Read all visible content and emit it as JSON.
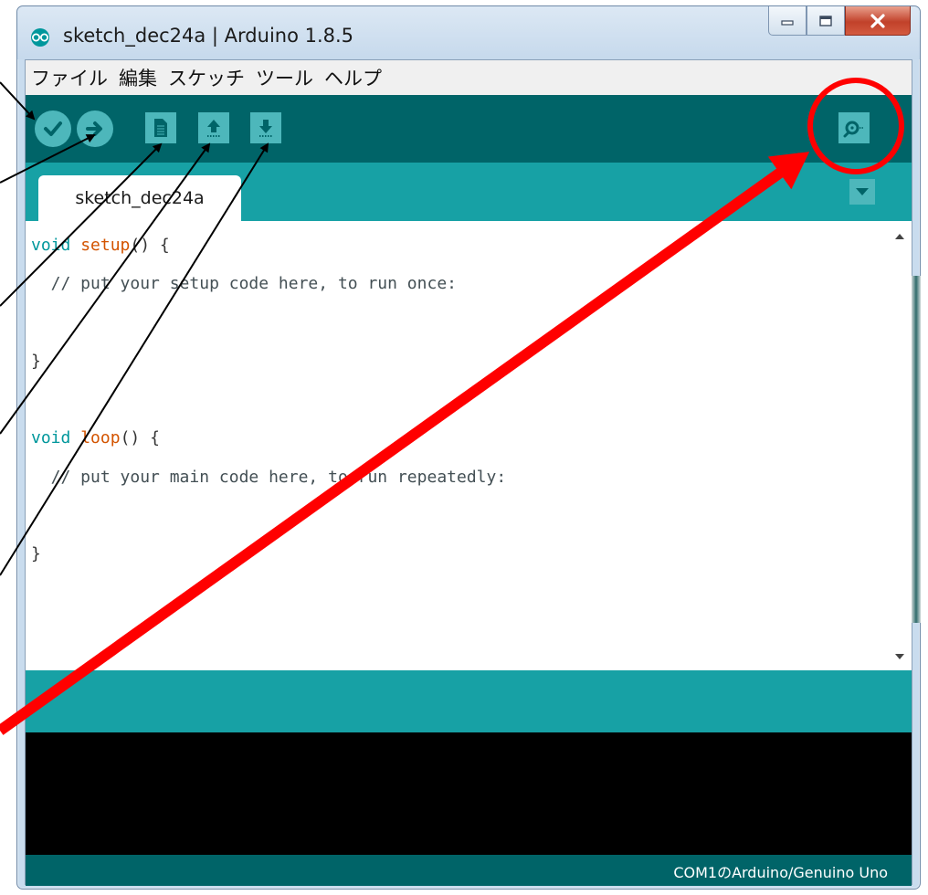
{
  "window": {
    "title": "sketch_dec24a | Arduino 1.8.5",
    "icon": "arduino-logo-icon"
  },
  "window_controls": {
    "minimize_icon": "minimize-icon",
    "maximize_icon": "maximize-icon",
    "close_icon": "close-icon"
  },
  "menu": {
    "items": [
      "ファイル",
      "編集",
      "スケッチ",
      "ツール",
      "ヘルプ"
    ]
  },
  "toolbar": {
    "buttons": [
      {
        "icon": "verify-icon"
      },
      {
        "icon": "upload-icon"
      },
      {
        "icon": "new-file-icon"
      },
      {
        "icon": "open-icon"
      },
      {
        "icon": "save-icon"
      }
    ],
    "serial_monitor_icon": "serial-monitor-icon"
  },
  "tabs": {
    "active": "sketch_dec24a",
    "menu_icon": "tab-menu-icon"
  },
  "editor": {
    "lines": [
      {
        "kw": "void",
        "fn": "setup",
        "rest": "() {"
      },
      {
        "text": "  // put your setup code here, to run once:"
      },
      {
        "text": ""
      },
      {
        "text": "}"
      },
      {
        "text": ""
      },
      {
        "kw": "void",
        "fn": "loop",
        "rest": "() {"
      },
      {
        "text": "  // put your main code here, to run repeatedly:"
      },
      {
        "text": ""
      },
      {
        "text": "}"
      }
    ]
  },
  "status": {
    "board": "COM1のArduino/Genuino Uno"
  },
  "colors": {
    "toolbar": "#006468",
    "tabbar": "#17a1a5",
    "button": "#4db7bb",
    "keyword": "#00979c",
    "function": "#d35400",
    "annotation_red": "#ff0000"
  }
}
